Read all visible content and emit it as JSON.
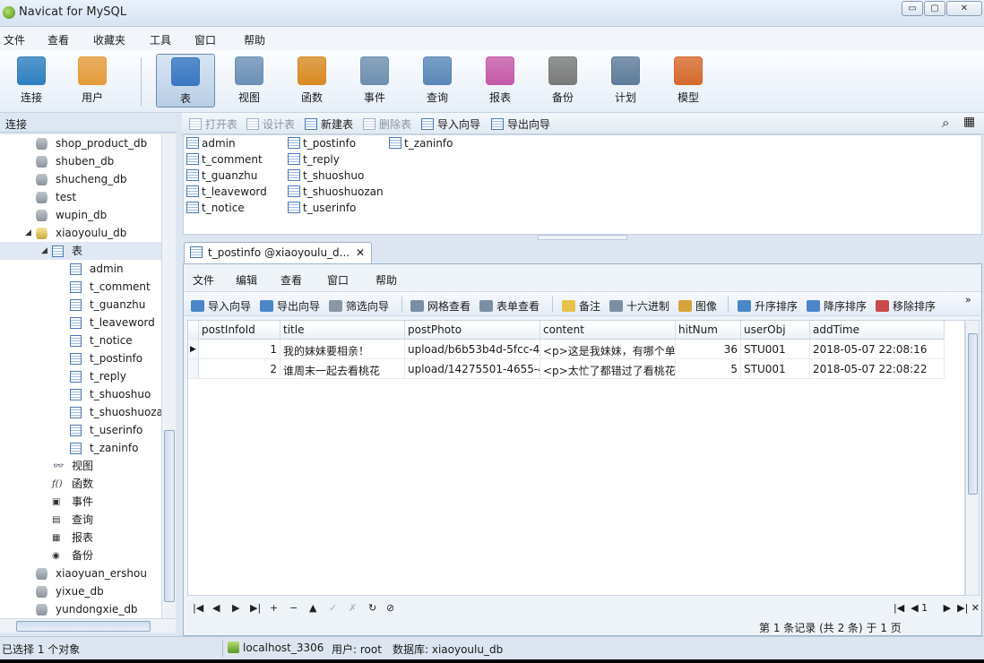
{
  "window": {
    "title": "Navicat for MySQL",
    "minimize": "▭",
    "maximize": "▢",
    "close": "✕"
  },
  "menubar": [
    "文件",
    "查看",
    "收藏夹",
    "工具",
    "窗口",
    "帮助"
  ],
  "toolbar": [
    {
      "label": "连接",
      "icon": "connection-icon",
      "color": "#2f7fc0"
    },
    {
      "label": "用户",
      "icon": "user-icon",
      "color": "#e59b3a"
    },
    {
      "label": "表",
      "icon": "table-icon",
      "color": "#3b78c2",
      "active": true
    },
    {
      "label": "视图",
      "icon": "view-icon",
      "color": "#6c8fb6"
    },
    {
      "label": "函数",
      "icon": "function-icon",
      "color": "#d98a22"
    },
    {
      "label": "事件",
      "icon": "event-icon",
      "color": "#6e8fae"
    },
    {
      "label": "查询",
      "icon": "query-icon",
      "color": "#5a87b8"
    },
    {
      "label": "报表",
      "icon": "report-icon",
      "color": "#c65aa8"
    },
    {
      "label": "备份",
      "icon": "backup-icon",
      "color": "#7a7a7a"
    },
    {
      "label": "计划",
      "icon": "schedule-icon",
      "color": "#5f7c9a"
    },
    {
      "label": "模型",
      "icon": "model-icon",
      "color": "#d76a2c"
    }
  ],
  "left_panel": {
    "header": "连接",
    "tree": [
      {
        "label": "shop_product_db",
        "type": "db",
        "level": 0
      },
      {
        "label": "shuben_db",
        "type": "db",
        "level": 0
      },
      {
        "label": "shucheng_db",
        "type": "db",
        "level": 0
      },
      {
        "label": "test",
        "type": "db",
        "level": 0
      },
      {
        "label": "wupin_db",
        "type": "db",
        "level": 0
      },
      {
        "label": "xiaoyoulu_db",
        "type": "db-open",
        "level": 0,
        "expander": "◢"
      },
      {
        "label": "表",
        "type": "table-group",
        "level": 1,
        "expander": "◢",
        "selected": true
      },
      {
        "label": "admin",
        "type": "table",
        "level": 2
      },
      {
        "label": "t_comment",
        "type": "table",
        "level": 2
      },
      {
        "label": "t_guanzhu",
        "type": "table",
        "level": 2
      },
      {
        "label": "t_leaveword",
        "type": "table",
        "level": 2
      },
      {
        "label": "t_notice",
        "type": "table",
        "level": 2
      },
      {
        "label": "t_postinfo",
        "type": "table",
        "level": 2
      },
      {
        "label": "t_reply",
        "type": "table",
        "level": 2
      },
      {
        "label": "t_shuoshuo",
        "type": "table",
        "level": 2
      },
      {
        "label": "t_shuoshuozan",
        "type": "table",
        "level": 2
      },
      {
        "label": "t_userinfo",
        "type": "table",
        "level": 2
      },
      {
        "label": "t_zaninfo",
        "type": "table",
        "level": 2
      },
      {
        "label": "视图",
        "type": "view",
        "level": 1,
        "glyph": "👓"
      },
      {
        "label": "函数",
        "type": "function",
        "level": 1,
        "glyph": "f()"
      },
      {
        "label": "事件",
        "type": "event",
        "level": 1,
        "glyph": "▣"
      },
      {
        "label": "查询",
        "type": "query",
        "level": 1,
        "glyph": "▤"
      },
      {
        "label": "报表",
        "type": "report",
        "level": 1,
        "glyph": "▦"
      },
      {
        "label": "备份",
        "type": "backup",
        "level": 1,
        "glyph": "◉"
      },
      {
        "label": "xiaoyuan_ershou",
        "type": "db",
        "level": 0
      },
      {
        "label": "yixue_db",
        "type": "db",
        "level": 0
      },
      {
        "label": "yundongxie_db",
        "type": "db",
        "level": 0
      }
    ]
  },
  "object_toolbar": [
    {
      "label": "打开表",
      "enabled": false
    },
    {
      "label": "设计表",
      "enabled": false
    },
    {
      "label": "新建表",
      "enabled": true
    },
    {
      "label": "删除表",
      "enabled": false
    },
    {
      "label": "导入向导",
      "enabled": true
    },
    {
      "label": "导出向导",
      "enabled": true
    }
  ],
  "object_list": {
    "col1": [
      "admin",
      "t_comment",
      "t_guanzhu",
      "t_leaveword",
      "t_notice"
    ],
    "col2": [
      "t_postinfo",
      "t_reply",
      "t_shuoshuo",
      "t_shuoshuozan",
      "t_userinfo"
    ],
    "col3": [
      "t_zaninfo"
    ]
  },
  "tab": {
    "label": "t_postinfo @xiaoyoulu_d...",
    "close": "✕"
  },
  "inner_menu": [
    "文件",
    "编辑",
    "查看",
    "窗口",
    "帮助"
  ],
  "inner_toolbar": [
    {
      "label": "导入向导",
      "color": "#4a86c8"
    },
    {
      "label": "导出向导",
      "color": "#4a86c8"
    },
    {
      "label": "筛选向导",
      "color": "#8a96a4"
    },
    {
      "label": "网格查看",
      "color": "#7c8ea3"
    },
    {
      "label": "表单查看",
      "color": "#7c8ea3"
    },
    {
      "label": "备注",
      "color": "#e8c14a"
    },
    {
      "label": "十六进制",
      "color": "#7c8ea3"
    },
    {
      "label": "图像",
      "color": "#d6a33a"
    },
    {
      "label": "升序排序",
      "color": "#4a86c8"
    },
    {
      "label": "降序排序",
      "color": "#4a86c8"
    },
    {
      "label": "移除排序",
      "color": "#c84a4a"
    }
  ],
  "grid": {
    "columns": [
      "postInfoId",
      "title",
      "postPhoto",
      "content",
      "hitNum",
      "userObj",
      "addTime"
    ],
    "rows": [
      [
        "1",
        "我的妹妹要相亲！",
        "upload/b6b53b4d-5fcc-4",
        "<p>这是我妹妹，有哪个单",
        "36",
        "STU001",
        "2018-05-07 22:08:16"
      ],
      [
        "2",
        "谁周末一起去看桃花",
        "upload/14275501-4655-4",
        "<p>太忙了都错过了看桃花",
        "5",
        "STU001",
        "2018-05-07 22:08:22"
      ]
    ],
    "current_row_marker": "▶"
  },
  "nav_buttons": [
    "|◀",
    "◀",
    "▶",
    "▶|",
    "+",
    "−",
    "▲",
    "✓",
    "✗",
    "↻",
    "⊘"
  ],
  "pager": {
    "first": "|◀",
    "prev": "◀",
    "page": "1",
    "next": "▶",
    "last": "▶|",
    "tools": "✕"
  },
  "record_info": "第 1 条记录 (共 2 条) 于 1 页",
  "status": {
    "selection": "已选择 1 个对象",
    "connection": "localhost_3306",
    "user": "用户: root",
    "database": "数据库: xiaoyoulu_db"
  }
}
